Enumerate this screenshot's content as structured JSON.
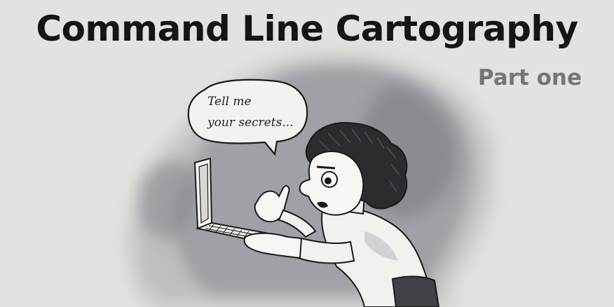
{
  "title": "Command Line Cartography",
  "subtitle": "Part one",
  "speech_bubble": {
    "line1": "Tell me",
    "line2": "your secrets..."
  },
  "colors": {
    "background": "#e3e2de",
    "title": "#151515",
    "subtitle": "#757575",
    "wash": "#8d9096"
  }
}
